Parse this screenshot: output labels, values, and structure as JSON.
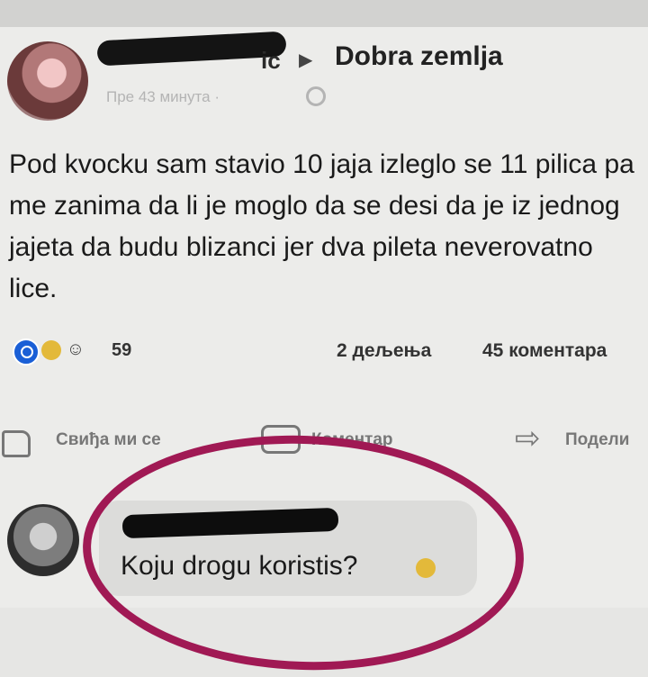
{
  "post": {
    "author_suffix": "ic",
    "arrow": "▶",
    "group": "Dobra zemlja",
    "time": "Пре 43 минута ·",
    "text": "Pod kvocku sam stavio 10 jaja izleglo se 11 pilica pa me zanima da li je moglo da se desi da je iz jednog jajeta da budu blizanci jer dva pileta neverovatno lice."
  },
  "reactions": {
    "count": "59",
    "shares": "2 дељења",
    "comments": "45 коментара",
    "icons": [
      "like-reaction-icon",
      "haha-reaction-icon",
      "wow-reaction-icon"
    ]
  },
  "actions": {
    "like": "Свиђа ми се",
    "comment": "Коментар",
    "share": "Подели"
  },
  "comment": {
    "text": "Koju drogu koristis?"
  },
  "colors": {
    "highlight_circle": "#a01954",
    "like_blue": "#1a5fd6"
  }
}
